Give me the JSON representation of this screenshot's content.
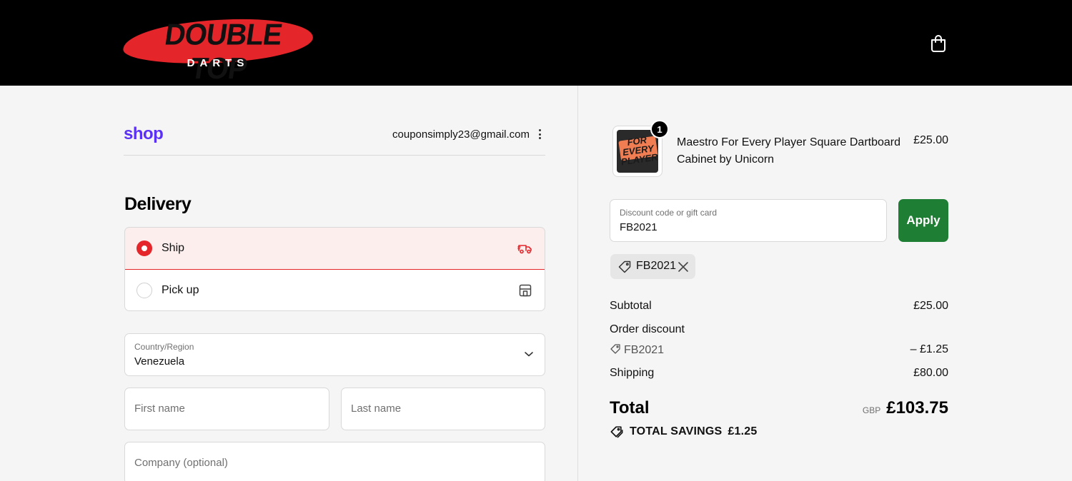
{
  "brand": {
    "logo_main": "DOUBLE TOP",
    "logo_sub": "DARTS",
    "accent": "#e4252a"
  },
  "header": {
    "cart_icon": "shopping-bag-icon"
  },
  "account": {
    "shop_logo": "shop",
    "email": "couponsimply23@gmail.com"
  },
  "delivery": {
    "title": "Delivery",
    "options": [
      {
        "label": "Ship",
        "selected": true,
        "icon": "truck-icon"
      },
      {
        "label": "Pick up",
        "selected": false,
        "icon": "store-icon"
      }
    ]
  },
  "address": {
    "country_label": "Country/Region",
    "country_value": "Venezuela",
    "first_name_placeholder": "First name",
    "last_name_placeholder": "Last name",
    "company_placeholder": "Company (optional)"
  },
  "order": {
    "product": {
      "title": "Maestro For Every Player Square Dartboard Cabinet by Unicorn",
      "price": "£25.00",
      "quantity": "1",
      "image_text": "FOR EVERY PLAYER"
    },
    "discount_field": {
      "label": "Discount code or gift card",
      "value": "FB2021"
    },
    "apply_label": "Apply",
    "applied_code": "FB2021",
    "subtotal_label": "Subtotal",
    "subtotal_value": "£25.00",
    "order_discount_label": "Order discount",
    "discount_code": "FB2021",
    "discount_value": "– £1.25",
    "shipping_label": "Shipping",
    "shipping_value": "£80.00",
    "total_label": "Total",
    "currency": "GBP",
    "total_value": "£103.75",
    "savings_label": "TOTAL SAVINGS",
    "savings_value": "£1.25",
    "apply_color": "#1e7e34"
  }
}
